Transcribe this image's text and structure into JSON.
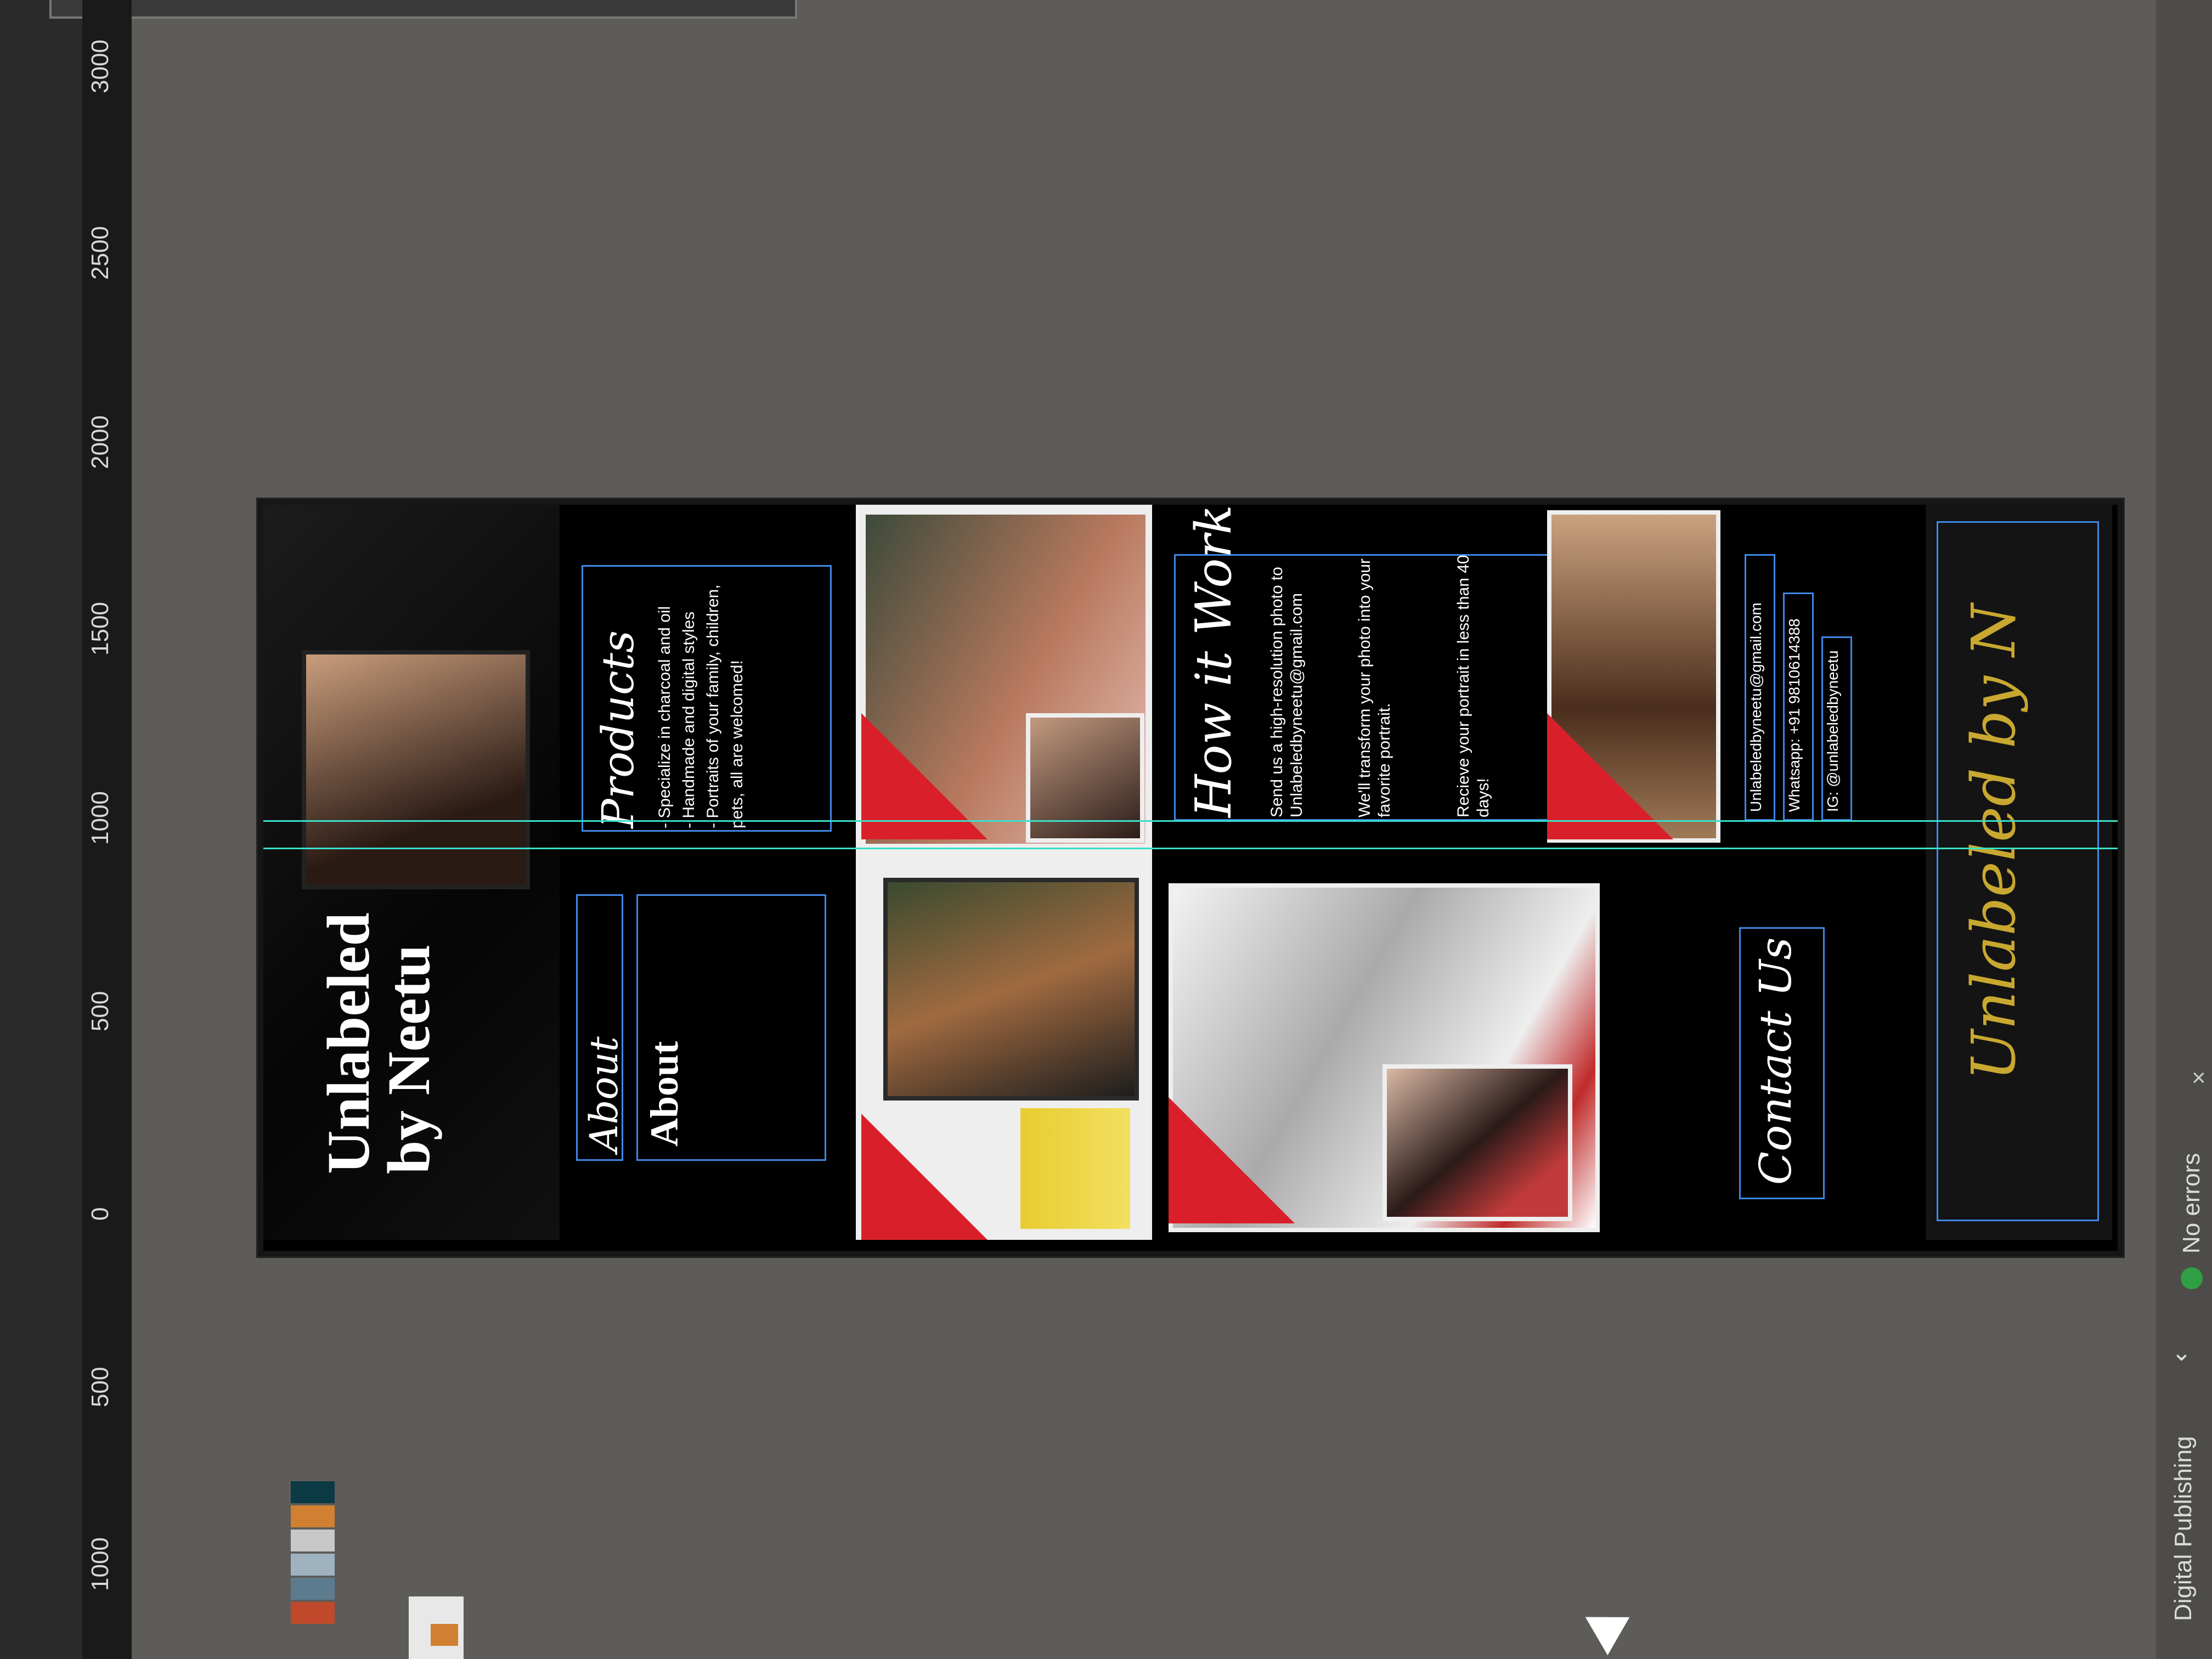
{
  "ruler": {
    "labels": [
      "3000",
      "2500",
      "2000",
      "1500",
      "1000",
      "500",
      "0",
      "500",
      "1000"
    ]
  },
  "panels": {
    "cover": {
      "title_line1": "Unlabeled",
      "title_line2": "by Neetu"
    },
    "about": {
      "heading_script": "About",
      "heading": "About"
    },
    "products": {
      "heading": "Products",
      "items": [
        "- Specialize in charcoal and oil",
        "- Handmade and digital styles",
        "- Portraits of your family, children, pets, all are welcomed!"
      ]
    },
    "how": {
      "heading": "How it Works",
      "steps": [
        "Send us a high-resolution photo to Unlabeledbyneetu@gmail.com",
        "We'll transform your photo into your favorite portrait.",
        "Recieve your portrait in less than 40 days!"
      ]
    },
    "contact": {
      "heading": "Contact Us",
      "email": "Unlabeledbyneetu@gmail.com",
      "whatsapp": "Whatsapp: +91 9810614388",
      "instagram": "IG: @unlabeledbyneetu"
    },
    "back": {
      "logo_text": "Unlabeled by N"
    }
  },
  "statusbar": {
    "workspace": "Digital Publishing",
    "errors": "No errors"
  },
  "colors": {
    "accent_red": "#d9202a",
    "guide_cyan": "#39e0c8",
    "frame_blue": "#3f88e6",
    "page_bg": "#000000"
  },
  "swatches": [
    "#0b3a44",
    "#d08030",
    "#c8c8c8",
    "#9fb2c0",
    "#5c7b8f",
    "#c0492c"
  ]
}
